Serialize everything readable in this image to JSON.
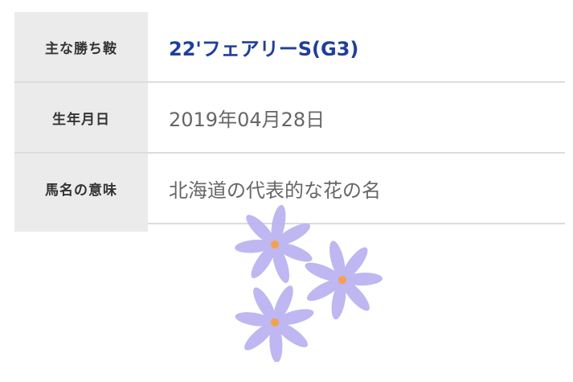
{
  "rows": [
    {
      "label": "主な勝ち鞍",
      "value": "22'フェアリーS(G3)",
      "is_link": true
    },
    {
      "label": "生年月日",
      "value": "2019年04月28日",
      "is_link": false
    },
    {
      "label": "馬名の意味",
      "value": "北海道の代表的な花の名",
      "is_link": false
    }
  ],
  "colors": {
    "label_bg": "#ebebeb",
    "link": "#1f3f9a",
    "value_text": "#666666",
    "divider": "#dcdcdc",
    "petal": "#b9b0f0",
    "flower_center": "#f5a14a"
  },
  "decoration": {
    "icon": "lavender-flower-cluster-icon"
  }
}
